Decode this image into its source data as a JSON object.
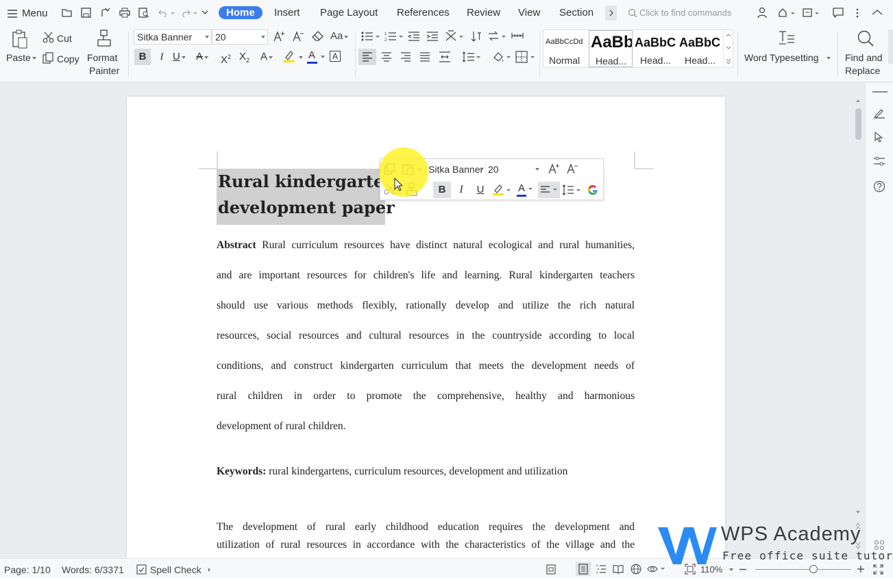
{
  "menu": {
    "label": "Menu"
  },
  "tabs": [
    {
      "label": "Home"
    },
    {
      "label": "Insert"
    },
    {
      "label": "Page Layout"
    },
    {
      "label": "References"
    },
    {
      "label": "Review"
    },
    {
      "label": "View"
    },
    {
      "label": "Section"
    }
  ],
  "search": {
    "placeholder": "Click to find commands"
  },
  "clipboard": {
    "paste": "Paste",
    "cut": "Cut",
    "copy": "Copy",
    "format_painter_1": "Format",
    "format_painter_2": "Painter"
  },
  "font": {
    "family": "Sitka Banner",
    "size": "20"
  },
  "styles": [
    {
      "preview": "AaBbCcDd",
      "label": "Normal"
    },
    {
      "preview": "AaBb",
      "label": "Head..."
    },
    {
      "preview": "AaBbC",
      "label": "Head..."
    },
    {
      "preview": "AaBbC",
      "label": "Head..."
    }
  ],
  "word_typesetting": "Word Typesetting",
  "find_replace": {
    "line1": "Find and",
    "line2": "Replace"
  },
  "mini_toolbar": {
    "font": "Sitka Banner",
    "size": "20"
  },
  "document": {
    "title_line1": "Rural kindergarten c",
    "title_line2": "development paper",
    "abstract_label": "Abstract",
    "abstract_lines": [
      " Rural curriculum resources have distinct natural ecological and rural humanities,",
      "and are important resources for children's life and learning. Rural kindergarten teachers",
      "should use various methods flexibly, rationally develop and utilize the rich natural",
      "resources, social resources and cultural resources in the countryside according to local",
      "conditions, and construct kindergarten curriculum that meets the development needs of",
      "rural children in order to promote the comprehensive, healthy and harmonious",
      "development of rural children."
    ],
    "keywords_label": "Keywords:",
    "keywords_text": " rural kindergartens, curriculum resources, development and utilization",
    "body_lines": [
      "The development of rural early childhood education requires the development and",
      "utilization of rural resources in accordance with the characteristics of the village and the"
    ]
  },
  "status": {
    "page": "Page: 1/10",
    "words": "Words: 6/3371",
    "spell": "Spell Check",
    "zoom": "110%",
    "zoom_fraction": 0.61
  },
  "watermark": {
    "brand": "WPS Academy",
    "tagline": "Free office suite tutorials"
  },
  "colors": {
    "accent": "#3d7dea",
    "highlight": "#f6e300",
    "font_color": "#1f3bd6"
  }
}
